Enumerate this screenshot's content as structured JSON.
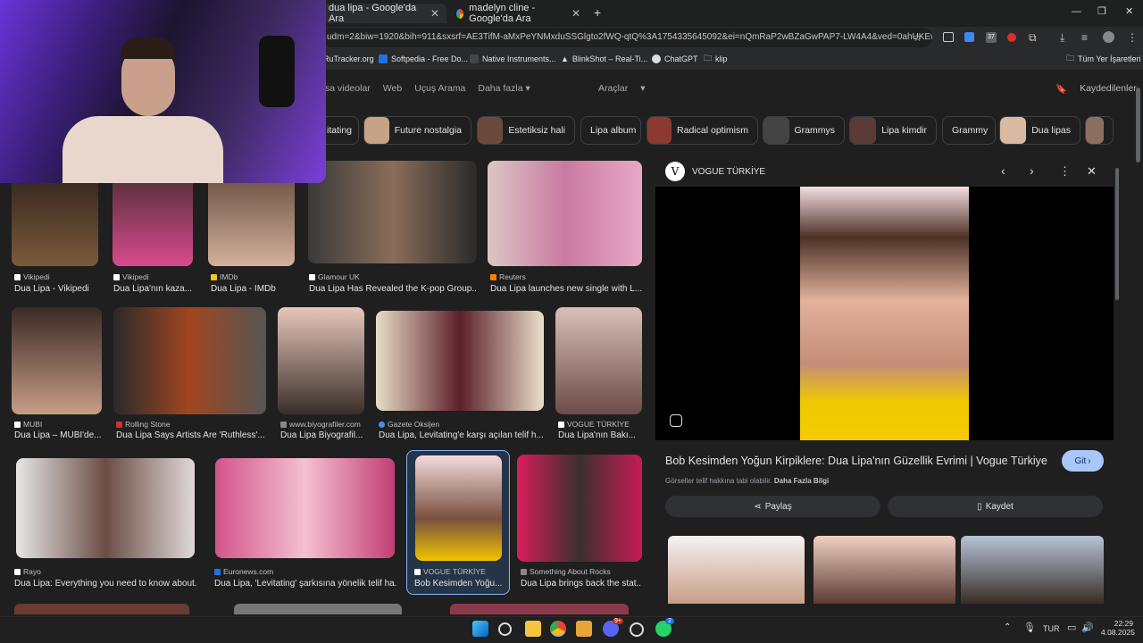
{
  "browser": {
    "tabs": [
      {
        "title": "dua lipa - Google'da Ara"
      },
      {
        "title": "madelyn cline - Google'da Ara"
      }
    ],
    "new_tab": "+",
    "url": "udm=2&biw=1920&bih=911&sxsrf=AE3TifM-aMxPeYNMxduSSGlgto2fWQ-qtQ%3A1754335645092&ei=nQmRaP2wBZaGwPAP7-LW4A4&ved=0ahUKEwi9...",
    "bookmarks": [
      "RuTracker.org",
      "Softpedia - Free Do...",
      "Native Instruments...",
      "BlinkShot – Real-Ti...",
      "ChatGPT",
      "klip"
    ],
    "all_bookmarks": "Tüm Yer İşaretleri",
    "ext_badge": "37"
  },
  "search": {
    "nav": [
      "sa videolar",
      "Web",
      "Uçuş Arama",
      "Daha fazla"
    ],
    "tools": "Araçlar",
    "saved": "Kaydedilenler",
    "chips": [
      "itating",
      "Future nostalgia",
      "Estetiksiz hali",
      "Lipa album",
      "Radical optimism",
      "Grammys",
      "Lipa kimdir",
      "Grammy",
      "Dua lipas"
    ]
  },
  "results": [
    {
      "source": "Vikipedi",
      "title": "Dua Lipa - Vikipedi"
    },
    {
      "source": "Vikipedi",
      "title": "Dua Lipa'nın kaza..."
    },
    {
      "source": "IMDb",
      "title": "Dua Lipa - IMDb"
    },
    {
      "source": "Glamour UK",
      "title": "Dua Lipa Has Revealed the K-pop Group..."
    },
    {
      "source": "Reuters",
      "title": "Dua Lipa launches new single with L..."
    },
    {
      "source": "MUBI",
      "title": "Dua Lipa – MUBI'de..."
    },
    {
      "source": "Rolling Stone",
      "title": "Dua Lipa Says Artists Are 'Ruthless'..."
    },
    {
      "source": "www.biyografiler.com",
      "title": "Dua Lipa Biyografil..."
    },
    {
      "source": "Gazete Oksijen",
      "title": "Dua Lipa, Levitating'e karşı açılan telif h..."
    },
    {
      "source": "VOGUE TÜRKİYE",
      "title": "Dua Lipa'nın Bakı..."
    },
    {
      "source": "Rayo",
      "title": "Dua Lipa: Everything you need to know about..."
    },
    {
      "source": "Euronews.com",
      "title": "Dua Lipa, 'Levitating' şarkısına yönelik telif ha..."
    },
    {
      "source": "VOGUE TÜRKİYE",
      "title": "Bob Kesimden Yoğu..."
    },
    {
      "source": "Something About Rocks",
      "title": "Dua Lipa brings back the stat..."
    }
  ],
  "preview": {
    "logo": "V",
    "source": "VOGUE TÜRKİYE",
    "title": "Bob Kesimden Yoğun Kirpiklere: Dua Lipa'nın Güzellik Evrimi | Vogue Türkiye",
    "go": "Git",
    "rights": "Görseller telif hakkına tabi olabilir.",
    "more_info": "Daha Fazla Bilgi",
    "share": "Paylaş",
    "save": "Kaydet"
  },
  "taskbar": {
    "lang": "TUR",
    "time": "22:29",
    "date": "4.08.2025",
    "badge1": "9+",
    "badge2": "2"
  },
  "colors": {
    "accent": "#8ab4f8",
    "go_button": "#a8c7fa"
  }
}
